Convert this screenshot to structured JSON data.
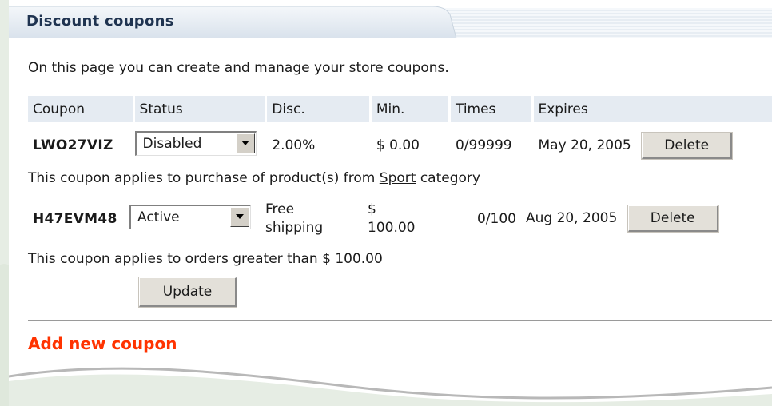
{
  "header": {
    "title": "Discount coupons"
  },
  "intro": "On this page you can create and manage your store coupons.",
  "table": {
    "columns": [
      "Coupon",
      "Status",
      "Disc.",
      "Min.",
      "Times",
      "Expires"
    ],
    "rows": [
      {
        "code": "LWO27VIZ",
        "status": "Disabled",
        "discount": "2.00%",
        "min": "$ 0.00",
        "times": "0/99999",
        "expires": "May 20, 2005",
        "delete_label": "Delete",
        "note_prefix": "This coupon applies to purchase of product(s) from ",
        "note_link": "Sport",
        "note_suffix": " category"
      },
      {
        "code": "H47EVM48",
        "status": "Active",
        "discount_line1": "Free",
        "discount_line2": "shipping",
        "min_line1": "$",
        "min_line2": "100.00",
        "times": "0/100",
        "expires": "Aug 20, 2005",
        "delete_label": "Delete",
        "note": "This coupon applies to orders greater than $ 100.00"
      }
    ]
  },
  "update_label": "Update",
  "add_new_label": "Add new coupon",
  "colors": {
    "accent": "#ff3300",
    "header_text": "#1f3350",
    "table_header_bg": "#e5ebf2"
  }
}
